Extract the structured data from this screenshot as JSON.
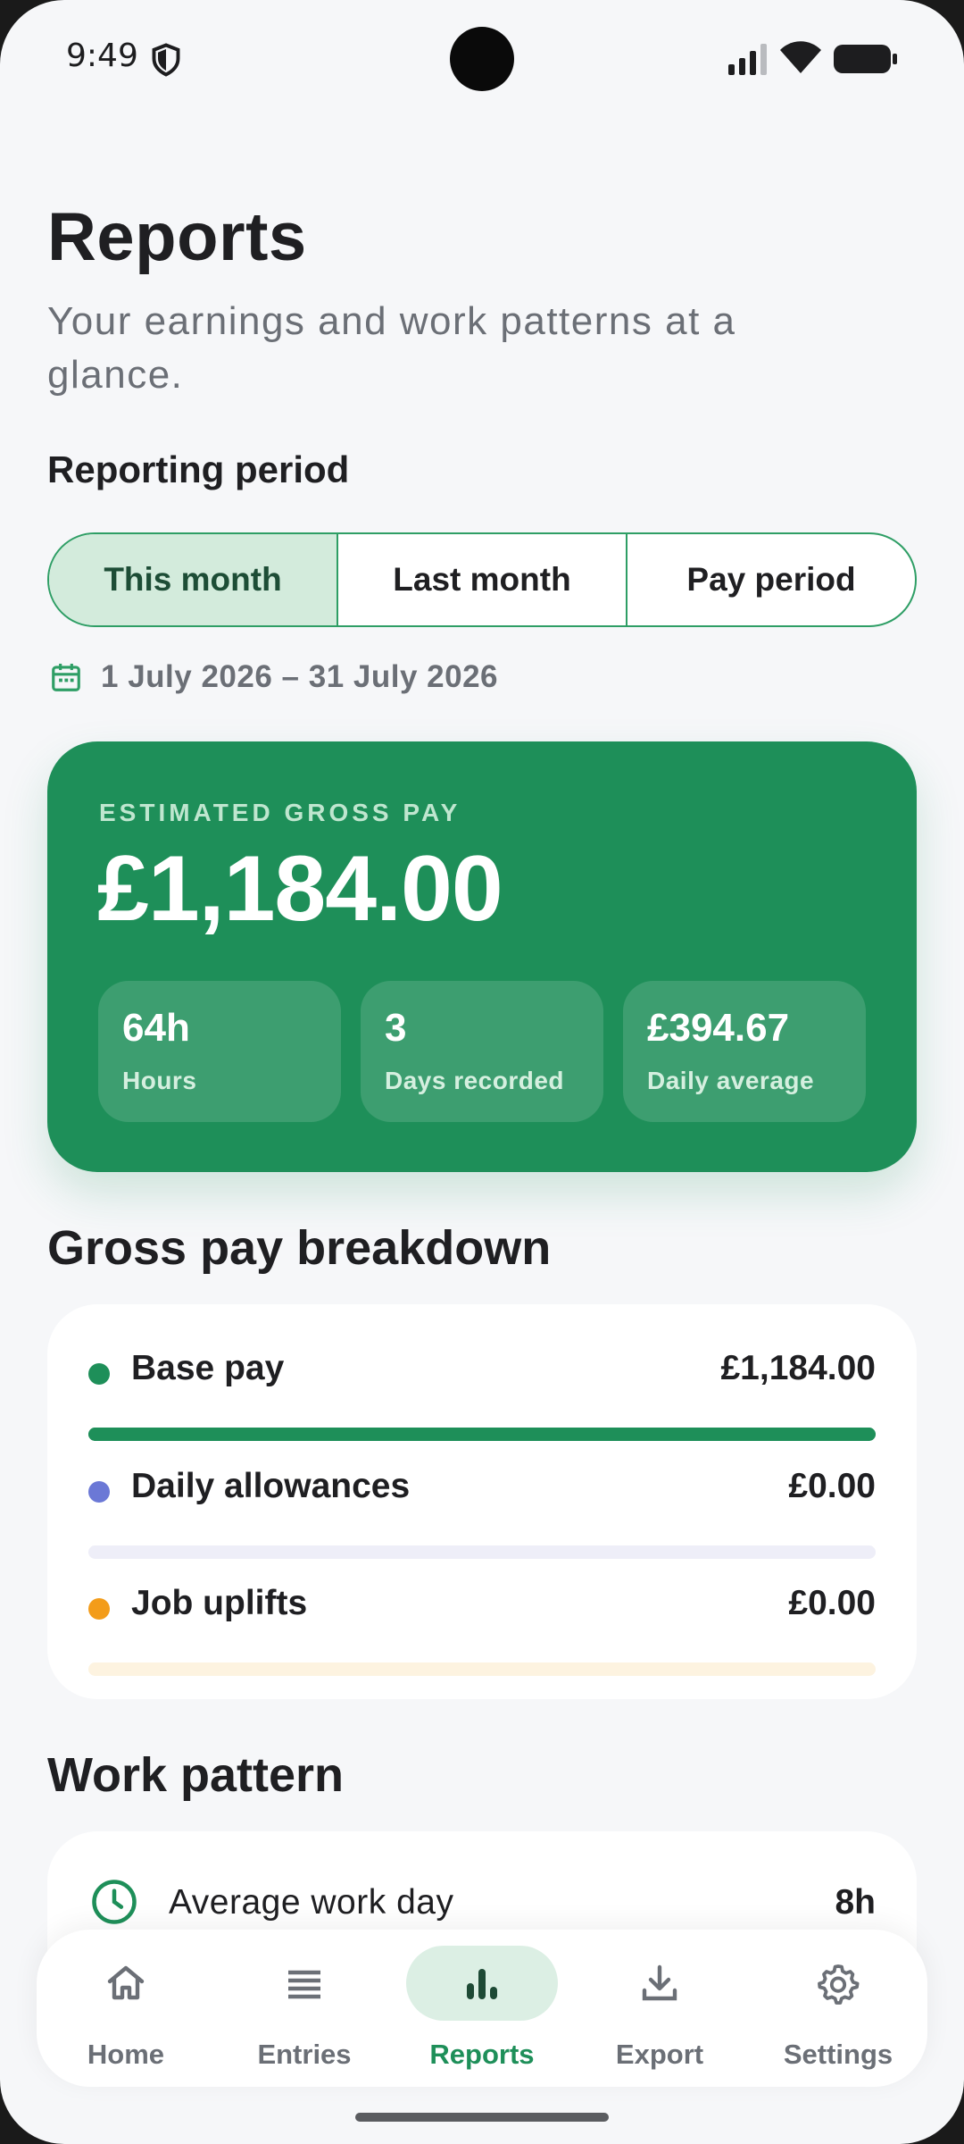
{
  "status_bar": {
    "time": "9:49"
  },
  "header": {
    "title": "Reports",
    "subtitle": "Your earnings and work patterns at a glance."
  },
  "period": {
    "label": "Reporting period",
    "options": [
      "This month",
      "Last month",
      "Pay period"
    ],
    "selected": "This month",
    "date_range": "1 July 2026 – 31 July 2026"
  },
  "summary": {
    "label": "ESTIMATED GROSS PAY",
    "value": "£1,184.00",
    "stats": [
      {
        "value": "64h",
        "label": "Hours"
      },
      {
        "value": "3",
        "label": "Days recorded"
      },
      {
        "value": "£394.67",
        "label": "Daily average"
      }
    ]
  },
  "breakdown": {
    "title": "Gross pay breakdown",
    "rows": [
      {
        "label": "Base pay",
        "value": "£1,184.00",
        "fraction": 1.0,
        "color": "#1e8f59",
        "track": "#1e8f59"
      },
      {
        "label": "Daily allowances",
        "value": "£0.00",
        "fraction": 0.0,
        "color": "#6b78d6",
        "track": "#eeeef8"
      },
      {
        "label": "Job uplifts",
        "value": "£0.00",
        "fraction": 0.0,
        "color": "#f39c1a",
        "track": "#fdf3e0"
      }
    ]
  },
  "work_pattern": {
    "title": "Work pattern",
    "rows": [
      {
        "label": "Average work day",
        "value": "8h"
      }
    ]
  },
  "nav": {
    "items": [
      {
        "label": "Home",
        "icon": "home-icon"
      },
      {
        "label": "Entries",
        "icon": "list-icon"
      },
      {
        "label": "Reports",
        "icon": "bar-chart-icon"
      },
      {
        "label": "Export",
        "icon": "download-icon"
      },
      {
        "label": "Settings",
        "icon": "gear-icon"
      }
    ],
    "active": "Reports"
  },
  "colors": {
    "brand": "#1e8f59",
    "brand_light": "#d3ebdc",
    "text": "#1f1f22",
    "muted": "#6b6f76",
    "background": "#f6f7f9"
  }
}
